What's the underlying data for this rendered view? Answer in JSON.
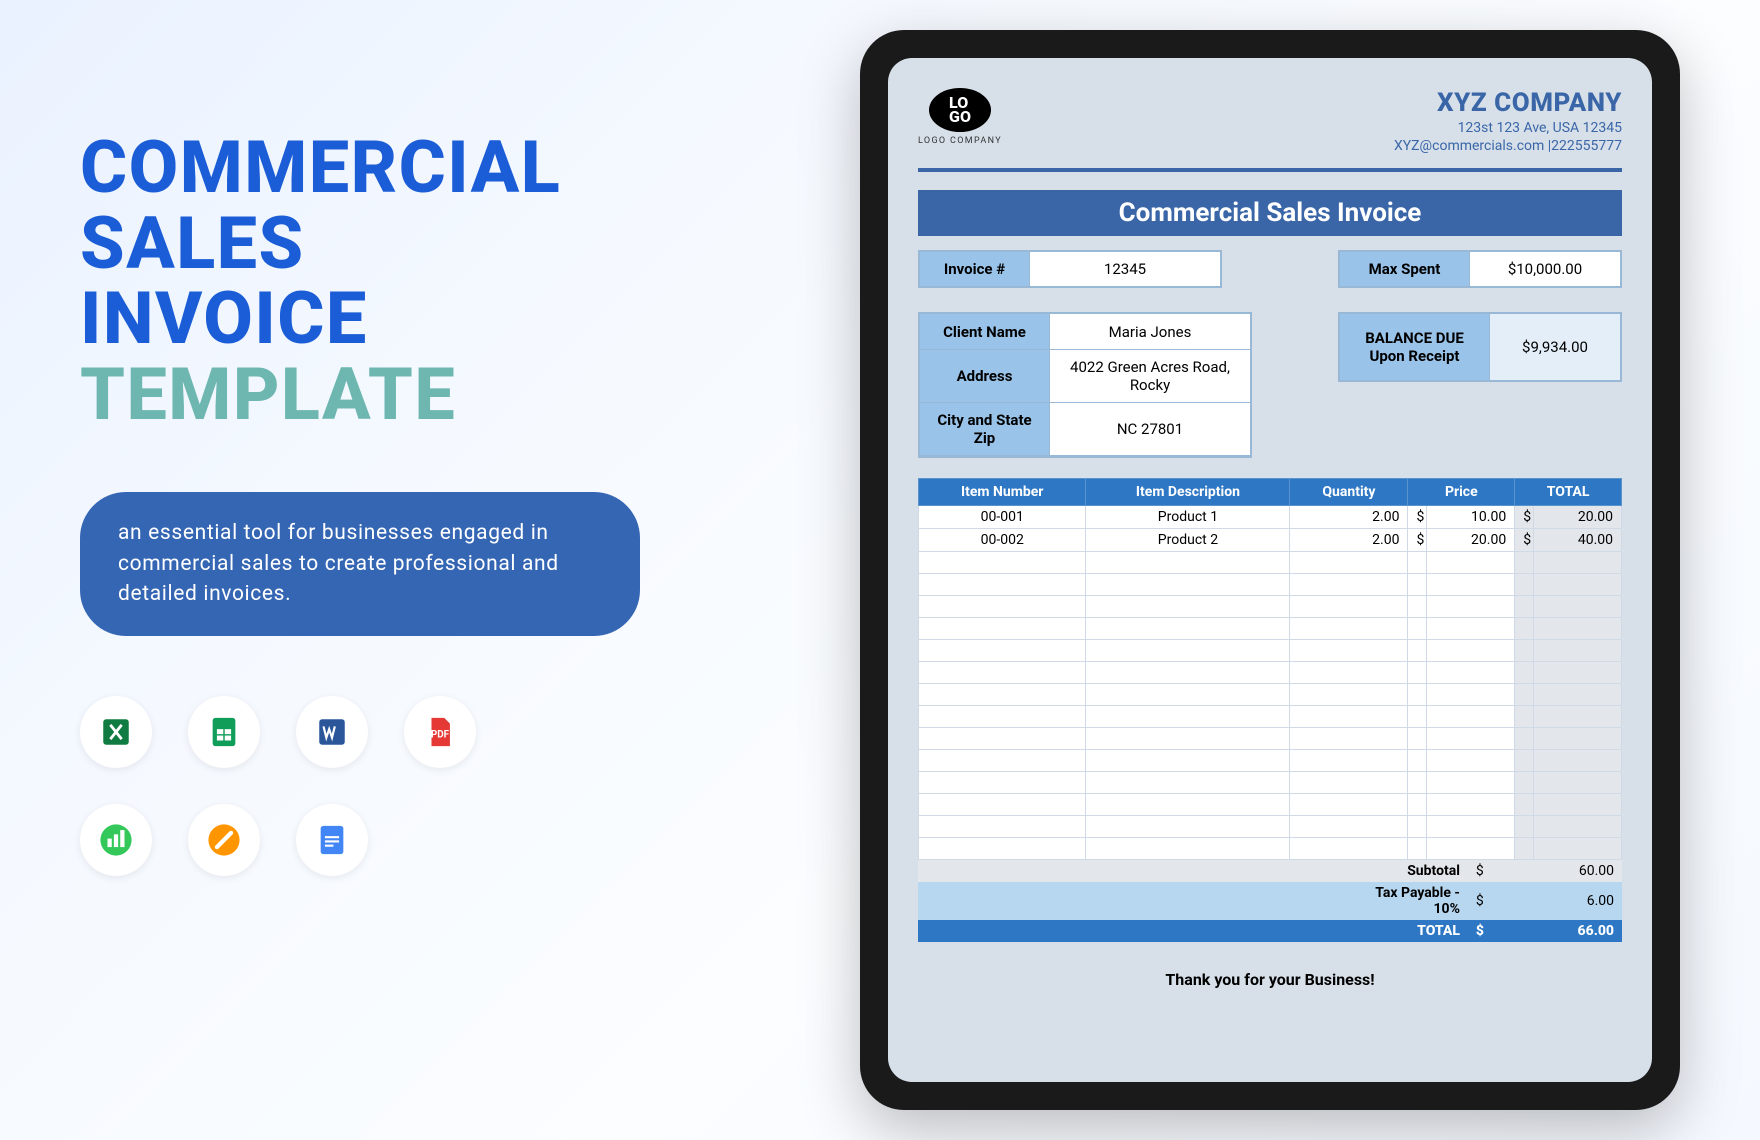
{
  "title": {
    "l1": "COMMERCIAL",
    "l2": "SALES",
    "l3": "INVOICE",
    "l4": "TEMPLATE"
  },
  "tagline": "an essential tool for businesses engaged in commercial sales to create professional and detailed invoices.",
  "icons": [
    "excel-icon",
    "sheets-icon",
    "word-icon",
    "pdf-icon",
    "numbers-icon",
    "pages-icon",
    "docs-icon"
  ],
  "company": {
    "logo_text": "LO\nGO",
    "logo_sub": "LOGO COMPANY",
    "name": "XYZ COMPANY",
    "addr": "123st 123 Ave, USA 12345",
    "contact": "XYZ@commercials.com |222555777"
  },
  "banner": "Commercial Sales Invoice",
  "fields": {
    "invoice_lbl": "Invoice #",
    "invoice_val": "12345",
    "maxspent_lbl": "Max Spent",
    "maxspent_val": "$10,000.00",
    "client_lbl": "Client Name",
    "client_val": "Maria Jones",
    "addr_lbl": "Address",
    "addr_val": "4022 Green Acres Road, Rocky",
    "city_lbl": "City and State Zip",
    "city_val": "NC 27801",
    "balance_lbl1": "BALANCE DUE",
    "balance_lbl2": "Upon Receipt",
    "balance_val": "$9,934.00"
  },
  "table": {
    "headers": [
      "Item Number",
      "Item Description",
      "Quantity",
      "Price",
      "TOTAL"
    ],
    "rows": [
      {
        "num": "00-001",
        "desc": "Product 1",
        "qty": "2.00",
        "price": "10.00",
        "total": "20.00"
      },
      {
        "num": "00-002",
        "desc": "Product 2",
        "qty": "2.00",
        "price": "20.00",
        "total": "40.00"
      }
    ],
    "empty_rows": 14
  },
  "summary": {
    "subtotal_lbl": "Subtotal",
    "subtotal": "60.00",
    "tax_lbl": "Tax Payable - 10%",
    "tax": "6.00",
    "total_lbl": "TOTAL",
    "total": "66.00"
  },
  "thanks": "Thank you for your Business!",
  "currency": "$"
}
